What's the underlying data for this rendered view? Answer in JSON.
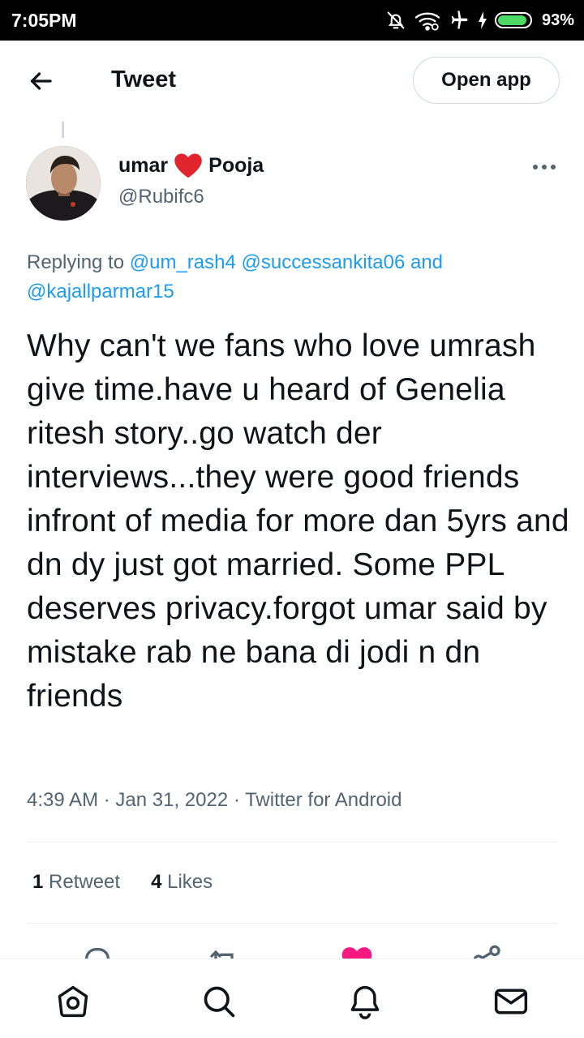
{
  "status_bar": {
    "time": "7:05PM",
    "battery_percent": "93%",
    "battery_level": 0.93,
    "icons": [
      "bell-muted-icon",
      "wifi-icon",
      "airplane-icon",
      "charging-icon",
      "battery-icon"
    ]
  },
  "header": {
    "title": "Tweet",
    "open_app_label": "Open app"
  },
  "tweet": {
    "author_first": "umar",
    "author_second": "Pooja",
    "handle": "@Rubifc6",
    "replying_prefix": "Replying to",
    "replying_mentions": [
      "@um_rash4",
      "@successankita06"
    ],
    "replying_and": "and",
    "replying_last": "@kajallparmar15",
    "text": "Why can't we fans who love umrash give time.have u heard of Genelia ritesh story..go watch der interviews...they were good friends infront of media for more dan 5yrs and dn dy just got married. Some PPL deserves privacy.forgot umar said by mistake rab ne bana di jodi n dn friends",
    "meta": "4:39 AM · Jan 31, 2022 · Twitter for Android"
  },
  "stats": {
    "retweets_count": "1",
    "retweets_label": "Retweet",
    "likes_count": "4",
    "likes_label": "Likes"
  },
  "colors": {
    "link": "#1d9bf0",
    "secondary_text": "#536471",
    "heart": "#f91880",
    "divider": "#eff3f4"
  },
  "bottom_nav": [
    "home-icon",
    "search-icon",
    "notifications-icon",
    "messages-icon"
  ]
}
